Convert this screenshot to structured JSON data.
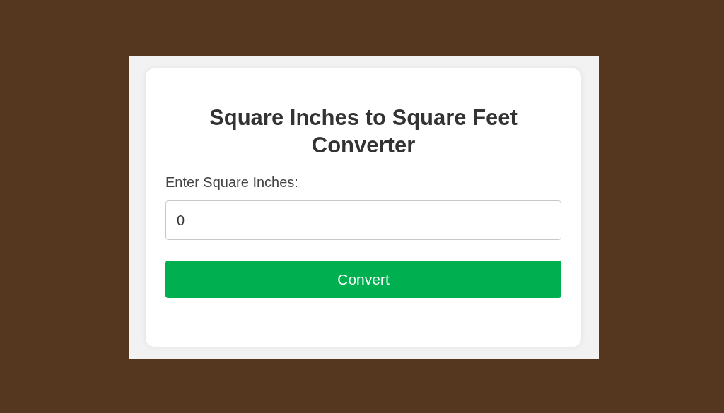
{
  "converter": {
    "title": "Square Inches to Square Feet Converter",
    "input_label": "Enter Square Inches:",
    "input_value": "0",
    "button": "Convert"
  }
}
